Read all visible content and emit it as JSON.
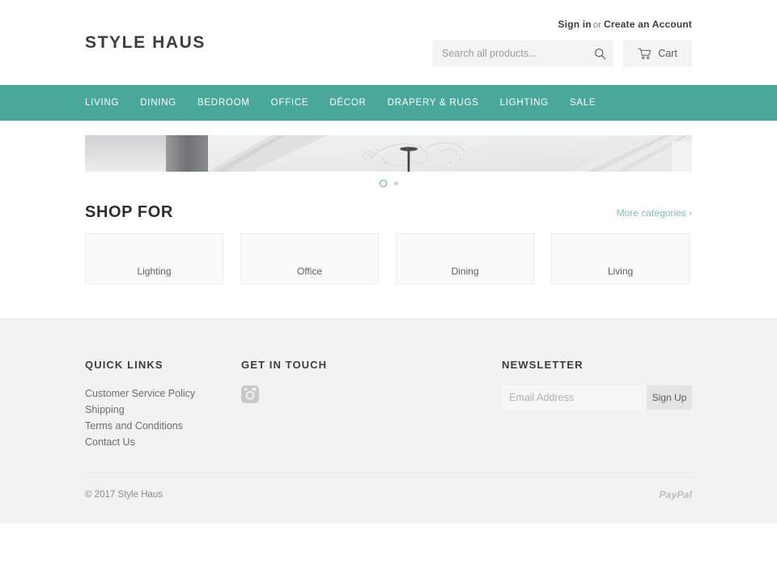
{
  "header": {
    "signin_label": "Sign in",
    "or_label": "or",
    "create_account_label": "Create an Account",
    "logo": "STYLE HAUS",
    "search": {
      "placeholder": "Search all products...",
      "value": "",
      "icon": "search-icon"
    },
    "cart": {
      "label": "Cart",
      "icon": "shopping-cart-icon"
    }
  },
  "nav": {
    "items": [
      {
        "label": "LIVING"
      },
      {
        "label": "DINING"
      },
      {
        "label": "BEDROOM"
      },
      {
        "label": "OFFICE"
      },
      {
        "label": "DÉCOR"
      },
      {
        "label": "DRAPERY & RUGS"
      },
      {
        "label": "LIGHTING"
      },
      {
        "label": "SALE"
      }
    ]
  },
  "hero": {
    "alt": "interior ceiling with pendant light",
    "slides": [
      {
        "state": "active"
      },
      {
        "state": "inactive"
      }
    ]
  },
  "shop": {
    "title": "SHOP FOR",
    "more_label": "More categories ›",
    "categories": [
      {
        "label": "Lighting"
      },
      {
        "label": "Office"
      },
      {
        "label": "Dining"
      },
      {
        "label": "Living"
      }
    ]
  },
  "footer": {
    "quick_links": {
      "title": "QUICK LINKS",
      "items": [
        {
          "label": "Customer Service Policy"
        },
        {
          "label": "Shipping"
        },
        {
          "label": "Terms and Conditions"
        },
        {
          "label": "Contact Us"
        }
      ]
    },
    "get_in_touch": {
      "title": "GET IN TOUCH",
      "social": [
        {
          "icon": "instagram-icon",
          "name": "Instagram"
        }
      ]
    },
    "newsletter": {
      "title": "NEWSLETTER",
      "placeholder": "Email Address",
      "value": "",
      "button_label": "Sign Up"
    },
    "copyright": "© 2017 Style Haus",
    "payment": "PayPal"
  },
  "colors": {
    "accent_teal": "#4aa89a",
    "link_teal": "#7fc0b4",
    "footer_bg": "#f2f2f2",
    "card_bg": "#fafafa",
    "text_dark": "#3d3d3d"
  }
}
